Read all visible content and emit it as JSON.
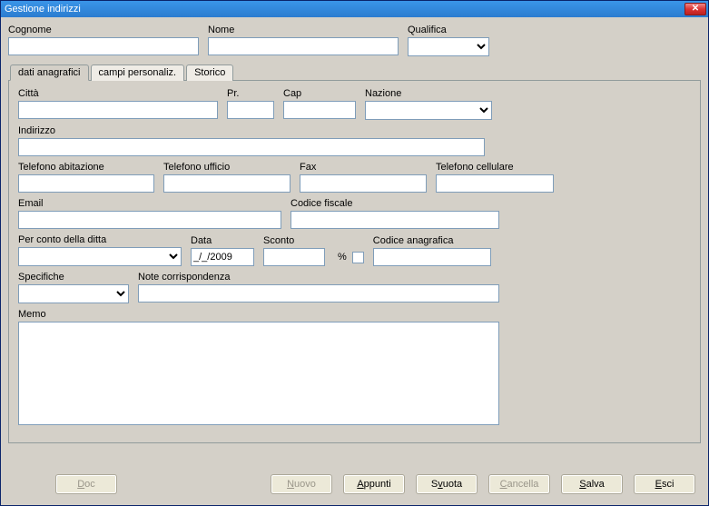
{
  "window": {
    "title": "Gestione indirizzi"
  },
  "header": {
    "cognome_label": "Cognome",
    "cognome_value": "",
    "nome_label": "Nome",
    "nome_value": "",
    "qualifica_label": "Qualifica",
    "qualifica_value": ""
  },
  "tabs": {
    "dati": "dati anagrafici",
    "campi": "campi personaliz.",
    "storico": "Storico"
  },
  "anag": {
    "citta_label": "Città",
    "citta_value": "",
    "pr_label": "Pr.",
    "pr_value": "",
    "cap_label": "Cap",
    "cap_value": "",
    "nazione_label": "Nazione",
    "nazione_value": "",
    "indirizzo_label": "Indirizzo",
    "indirizzo_value": "",
    "tel_ab_label": "Telefono abitazione",
    "tel_ab_value": "",
    "tel_uf_label": "Telefono ufficio",
    "tel_uf_value": "",
    "fax_label": "Fax",
    "fax_value": "",
    "tel_cell_label": "Telefono cellulare",
    "tel_cell_value": "",
    "email_label": "Email",
    "email_value": "",
    "cf_label": "Codice fiscale",
    "cf_value": "",
    "ditta_label": "Per conto della ditta",
    "ditta_value": "",
    "data_label": "Data",
    "data_value": "_/_/2009",
    "sconto_label": "Sconto",
    "sconto_value": "",
    "sconto_pct": "%",
    "codanag_label": "Codice anagrafica",
    "codanag_value": "",
    "specifiche_label": "Specifiche",
    "specifiche_value": "",
    "notecorr_label": "Note corrispondenza",
    "notecorr_value": "",
    "memo_label": "Memo",
    "memo_value": ""
  },
  "buttons": {
    "doc_pre": "",
    "doc_ul": "D",
    "doc_post": "oc",
    "nuovo_pre": "",
    "nuovo_ul": "N",
    "nuovo_post": "uovo",
    "appunti_pre": "",
    "appunti_ul": "A",
    "appunti_post": "ppunti",
    "svuota_pre": "S",
    "svuota_ul": "v",
    "svuota_post": "uota",
    "cancella_pre": "",
    "cancella_ul": "C",
    "cancella_post": "ancella",
    "salva_pre": "",
    "salva_ul": "S",
    "salva_post": "alva",
    "esci_pre": "",
    "esci_ul": "E",
    "esci_post": "sci"
  }
}
